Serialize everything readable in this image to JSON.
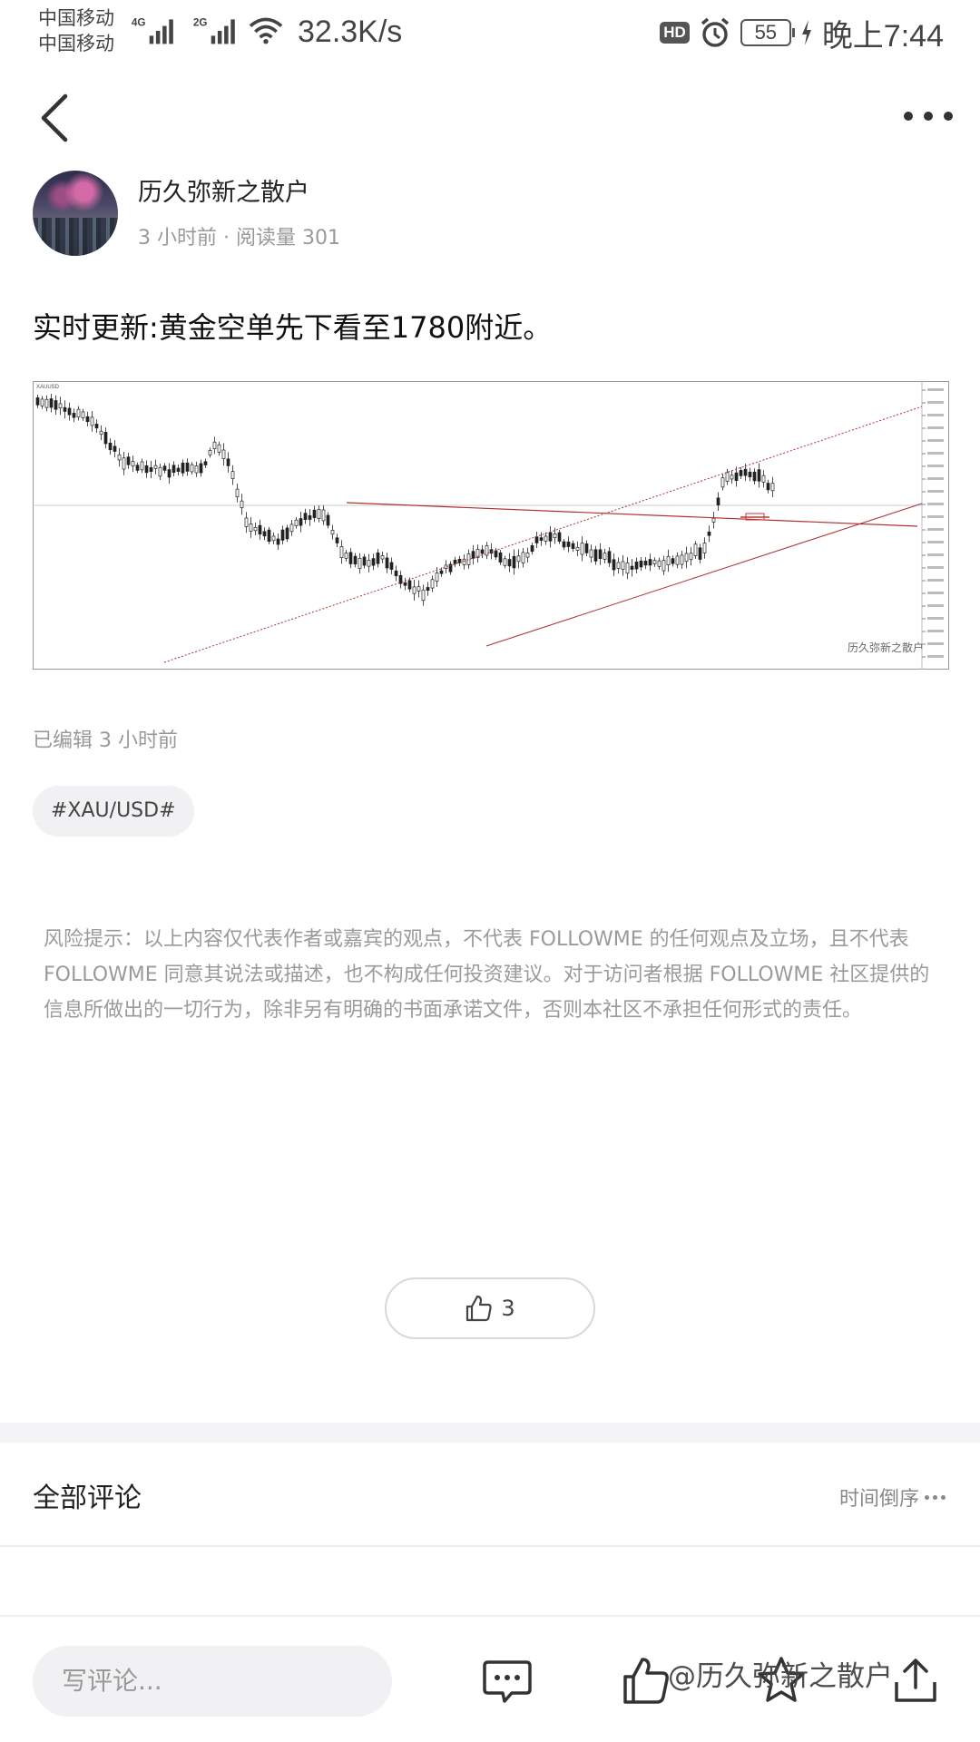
{
  "status_bar": {
    "carrier_1": "中国移动",
    "carrier_2": "中国移动",
    "net_1": "4G",
    "net_2": "2G",
    "net_speed": "32.3K/s",
    "hd": "HD",
    "battery": "55",
    "time": "晚上7:44"
  },
  "author": {
    "name": "历久弥新之散户",
    "meta": "3 小时前 · 阅读量 301"
  },
  "post": {
    "title": "实时更新:黄金空单先下看至1780附近。",
    "edited": "已编辑 3 小时前",
    "tag": "#XAU/USD#",
    "risk_notice": "风险提示：以上内容仅代表作者或嘉宾的观点，不代表 FOLLOWME 的任何观点及立场，且不代表 FOLLOWME 同意其说法或描述，也不构成任何投资建议。对于访问者根据 FOLLOWME 社区提供的信息所做出的一切行为，除非另有明确的书面承诺文件，否则本社区不承担任何形式的责任。"
  },
  "like": {
    "count": "3"
  },
  "comments": {
    "title": "全部评论",
    "sort_label": "时间倒序"
  },
  "bottom_bar": {
    "comment_placeholder": "写评论...",
    "watermark": "@历久弥新之散户"
  },
  "chart_image": {
    "symbol": "XAUUSD",
    "colors": {
      "candle": "#222222",
      "channel": "#b03030",
      "level": "#cc3333"
    },
    "annotation": "历久弥新之散户"
  },
  "icons": {
    "back": "chevron-left-icon",
    "more": "more-dots-icon",
    "like": "thumbs-up-icon",
    "comment": "comment-bubble-icon",
    "favorite": "star-icon",
    "share": "share-icon"
  }
}
